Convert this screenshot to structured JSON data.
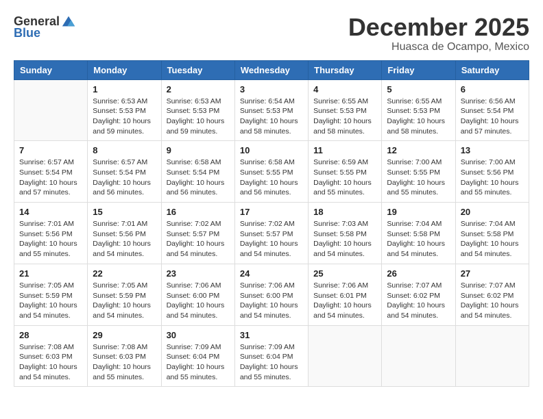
{
  "header": {
    "logo_general": "General",
    "logo_blue": "Blue",
    "month": "December 2025",
    "location": "Huasca de Ocampo, Mexico"
  },
  "days_of_week": [
    "Sunday",
    "Monday",
    "Tuesday",
    "Wednesday",
    "Thursday",
    "Friday",
    "Saturday"
  ],
  "weeks": [
    [
      {
        "day": "",
        "empty": true
      },
      {
        "day": "1",
        "sunrise": "6:53 AM",
        "sunset": "5:53 PM",
        "daylight": "10 hours and 59 minutes."
      },
      {
        "day": "2",
        "sunrise": "6:53 AM",
        "sunset": "5:53 PM",
        "daylight": "10 hours and 59 minutes."
      },
      {
        "day": "3",
        "sunrise": "6:54 AM",
        "sunset": "5:53 PM",
        "daylight": "10 hours and 58 minutes."
      },
      {
        "day": "4",
        "sunrise": "6:55 AM",
        "sunset": "5:53 PM",
        "daylight": "10 hours and 58 minutes."
      },
      {
        "day": "5",
        "sunrise": "6:55 AM",
        "sunset": "5:53 PM",
        "daylight": "10 hours and 58 minutes."
      },
      {
        "day": "6",
        "sunrise": "6:56 AM",
        "sunset": "5:54 PM",
        "daylight": "10 hours and 57 minutes."
      }
    ],
    [
      {
        "day": "7",
        "sunrise": "6:57 AM",
        "sunset": "5:54 PM",
        "daylight": "10 hours and 57 minutes."
      },
      {
        "day": "8",
        "sunrise": "6:57 AM",
        "sunset": "5:54 PM",
        "daylight": "10 hours and 56 minutes."
      },
      {
        "day": "9",
        "sunrise": "6:58 AM",
        "sunset": "5:54 PM",
        "daylight": "10 hours and 56 minutes."
      },
      {
        "day": "10",
        "sunrise": "6:58 AM",
        "sunset": "5:55 PM",
        "daylight": "10 hours and 56 minutes."
      },
      {
        "day": "11",
        "sunrise": "6:59 AM",
        "sunset": "5:55 PM",
        "daylight": "10 hours and 55 minutes."
      },
      {
        "day": "12",
        "sunrise": "7:00 AM",
        "sunset": "5:55 PM",
        "daylight": "10 hours and 55 minutes."
      },
      {
        "day": "13",
        "sunrise": "7:00 AM",
        "sunset": "5:56 PM",
        "daylight": "10 hours and 55 minutes."
      }
    ],
    [
      {
        "day": "14",
        "sunrise": "7:01 AM",
        "sunset": "5:56 PM",
        "daylight": "10 hours and 55 minutes."
      },
      {
        "day": "15",
        "sunrise": "7:01 AM",
        "sunset": "5:56 PM",
        "daylight": "10 hours and 54 minutes."
      },
      {
        "day": "16",
        "sunrise": "7:02 AM",
        "sunset": "5:57 PM",
        "daylight": "10 hours and 54 minutes."
      },
      {
        "day": "17",
        "sunrise": "7:02 AM",
        "sunset": "5:57 PM",
        "daylight": "10 hours and 54 minutes."
      },
      {
        "day": "18",
        "sunrise": "7:03 AM",
        "sunset": "5:58 PM",
        "daylight": "10 hours and 54 minutes."
      },
      {
        "day": "19",
        "sunrise": "7:04 AM",
        "sunset": "5:58 PM",
        "daylight": "10 hours and 54 minutes."
      },
      {
        "day": "20",
        "sunrise": "7:04 AM",
        "sunset": "5:58 PM",
        "daylight": "10 hours and 54 minutes."
      }
    ],
    [
      {
        "day": "21",
        "sunrise": "7:05 AM",
        "sunset": "5:59 PM",
        "daylight": "10 hours and 54 minutes."
      },
      {
        "day": "22",
        "sunrise": "7:05 AM",
        "sunset": "5:59 PM",
        "daylight": "10 hours and 54 minutes."
      },
      {
        "day": "23",
        "sunrise": "7:06 AM",
        "sunset": "6:00 PM",
        "daylight": "10 hours and 54 minutes."
      },
      {
        "day": "24",
        "sunrise": "7:06 AM",
        "sunset": "6:00 PM",
        "daylight": "10 hours and 54 minutes."
      },
      {
        "day": "25",
        "sunrise": "7:06 AM",
        "sunset": "6:01 PM",
        "daylight": "10 hours and 54 minutes."
      },
      {
        "day": "26",
        "sunrise": "7:07 AM",
        "sunset": "6:02 PM",
        "daylight": "10 hours and 54 minutes."
      },
      {
        "day": "27",
        "sunrise": "7:07 AM",
        "sunset": "6:02 PM",
        "daylight": "10 hours and 54 minutes."
      }
    ],
    [
      {
        "day": "28",
        "sunrise": "7:08 AM",
        "sunset": "6:03 PM",
        "daylight": "10 hours and 54 minutes."
      },
      {
        "day": "29",
        "sunrise": "7:08 AM",
        "sunset": "6:03 PM",
        "daylight": "10 hours and 55 minutes."
      },
      {
        "day": "30",
        "sunrise": "7:09 AM",
        "sunset": "6:04 PM",
        "daylight": "10 hours and 55 minutes."
      },
      {
        "day": "31",
        "sunrise": "7:09 AM",
        "sunset": "6:04 PM",
        "daylight": "10 hours and 55 minutes."
      },
      {
        "day": "",
        "empty": true
      },
      {
        "day": "",
        "empty": true
      },
      {
        "day": "",
        "empty": true
      }
    ]
  ]
}
